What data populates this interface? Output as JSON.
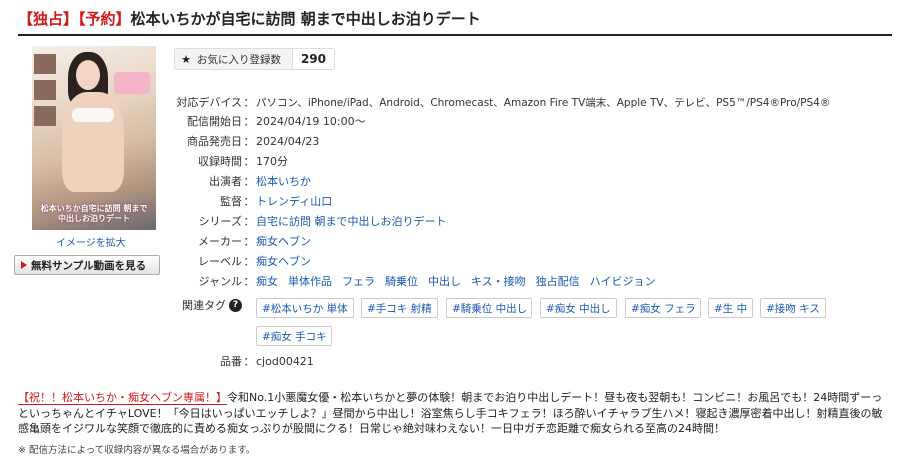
{
  "title": {
    "tag1": "【独占】",
    "tag2": "【予約】",
    "text": "松本いちかが自宅に訪問 朝まで中出しお泊りデート"
  },
  "cover": {
    "text": "松本いちか自宅に訪問 朝まで中出しお泊りデート"
  },
  "enlarge_link": "イメージを拡大",
  "sample_button": "無料サンプル動画を見る",
  "favorite": {
    "label": "お気に入り登録数",
    "count": "290"
  },
  "details": {
    "devices": {
      "label": "対応デバイス",
      "value": "パソコン、iPhone/iPad、Android、Chromecast、Amazon Fire TV端末、Apple TV、テレビ、PS5™/PS4®Pro/PS4®"
    },
    "release": {
      "label": "配信開始日",
      "value": "2024/04/19 10:00〜"
    },
    "sale": {
      "label": "商品発売日",
      "value": "2024/04/23"
    },
    "duration": {
      "label": "収録時間",
      "value": "170分"
    },
    "cast": {
      "label": "出演者",
      "value": "松本いちか"
    },
    "director": {
      "label": "監督",
      "value": "トレンディ山口"
    },
    "series": {
      "label": "シリーズ",
      "value": "自宅に訪問 朝まで中出しお泊りデート"
    },
    "maker": {
      "label": "メーカー",
      "value": "痴女ヘブン"
    },
    "label_row": {
      "label": "レーベル",
      "value": "痴女ヘブン"
    },
    "genre": {
      "label": "ジャンル",
      "items": [
        "痴女",
        "単体作品",
        "フェラ",
        "騎乗位",
        "中出し",
        "キス・接吻",
        "独占配信",
        "ハイビジョン"
      ]
    },
    "tags": {
      "label": "関連タグ",
      "items": [
        "#松本いちか 単体",
        "#手コキ 射精",
        "#騎乗位 中出し",
        "#痴女 中出し",
        "#痴女 フェラ",
        "#生 中",
        "#接吻 キス",
        "#痴女 手コキ"
      ]
    },
    "code": {
      "label": "品番",
      "value": "cjod00421"
    }
  },
  "description": {
    "highlight": "【祝！！松本いちか・痴女ヘブン専属！】",
    "text": "令和No.1小悪魔女優・松本いちかと夢の体験！朝までお泊り中出しデート！昼も夜も翌朝も！コンビニ！お風呂でも！24時間ずーっといっちゃんとイチャLOVE！「今日はいっぱいエッチしよ？」昼間から中出し！浴室焦らし手コキフェラ！ほろ酔いイチャラブ生ハメ！寝起き濃厚密着中出し！射精直後の敏感亀頭をイジワルな笑顔で徹底的に責める痴女っぷりが股間にクる！日常じゃ絶対味わえない！一日中ガチ恋距離で痴女られる至高の24時間！"
  },
  "note": "※ 配信方法によって収録内容が異なる場合があります。"
}
